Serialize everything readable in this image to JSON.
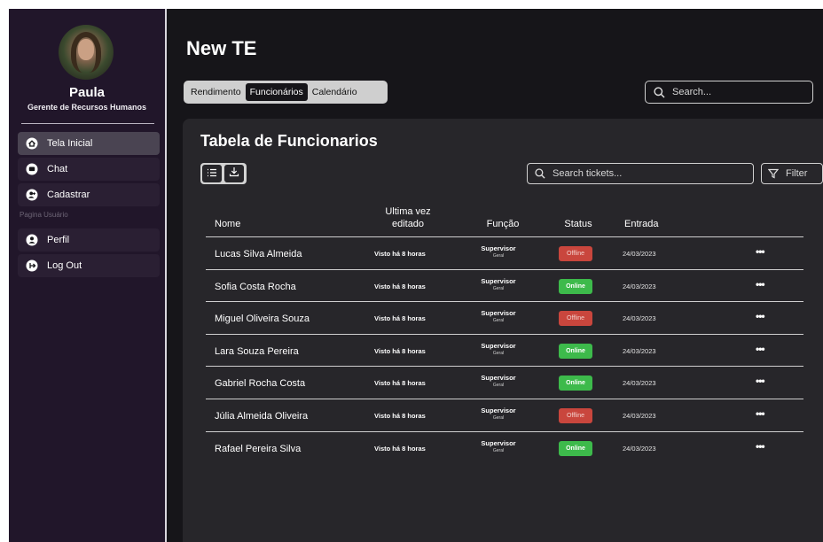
{
  "user": {
    "name": "Paula",
    "role": "Gerente de Recursos Humanos"
  },
  "sidebar": {
    "items": [
      {
        "label": "Tela Inicial",
        "icon": "home-icon",
        "active": true
      },
      {
        "label": "Chat",
        "icon": "chat-icon",
        "active": false
      },
      {
        "label": "Cadastrar",
        "icon": "add-user-icon",
        "active": false
      }
    ],
    "section_label": "Pagina Usuário",
    "user_items": [
      {
        "label": "Perfil",
        "icon": "user-icon"
      },
      {
        "label": "Log Out",
        "icon": "logout-icon"
      }
    ]
  },
  "header": {
    "title": "New TE",
    "tabs": [
      {
        "label": "Rendimento",
        "active": false
      },
      {
        "label": "Funcionários",
        "active": true
      },
      {
        "label": "Calendário",
        "active": false
      }
    ],
    "search_placeholder": "Search..."
  },
  "panel": {
    "title": "Tabela de Funcionarios",
    "search_placeholder": "Search tickets...",
    "filter_label": "Filter"
  },
  "table": {
    "headers": {
      "name": "Nome",
      "edited_line1": "Ultima vez",
      "edited_line2": "editado",
      "role": "Função",
      "status": "Status",
      "date": "Entrada"
    },
    "rows": [
      {
        "name": "Lucas Silva Almeida",
        "edited": "Visto há 8 horas",
        "role": "Supervisor",
        "role_sub": "Geral",
        "status": "Offline",
        "date": "24/03/2023"
      },
      {
        "name": "Sofia Costa Rocha",
        "edited": "Visto há 8 horas",
        "role": "Supervisor",
        "role_sub": "Geral",
        "status": "Online",
        "date": "24/03/2023"
      },
      {
        "name": "Miguel Oliveira Souza",
        "edited": "Visto há 8 horas",
        "role": "Supervisor",
        "role_sub": "Geral",
        "status": "Offline",
        "date": "24/03/2023"
      },
      {
        "name": "Lara Souza Pereira",
        "edited": "Visto há 8 horas",
        "role": "Supervisor",
        "role_sub": "Geral",
        "status": "Online",
        "date": "24/03/2023"
      },
      {
        "name": "Gabriel Rocha Costa",
        "edited": "Visto há 8 horas",
        "role": "Supervisor",
        "role_sub": "Geral",
        "status": "Online",
        "date": "24/03/2023"
      },
      {
        "name": "Júlia Almeida Oliveira",
        "edited": "Visto há 8 horas",
        "role": "Supervisor",
        "role_sub": "Geral",
        "status": "Offline",
        "date": "24/03/2023"
      },
      {
        "name": "Rafael Pereira Silva",
        "edited": "Visto há 8 horas",
        "role": "Supervisor",
        "role_sub": "Geral",
        "status": "Online",
        "date": "24/03/2023"
      }
    ],
    "row_menu": "•••"
  },
  "colors": {
    "background": "#161519",
    "sidebar": "#21162a",
    "panel": "#27262a",
    "online": "#3dba4b",
    "offline": "#c9463d"
  }
}
